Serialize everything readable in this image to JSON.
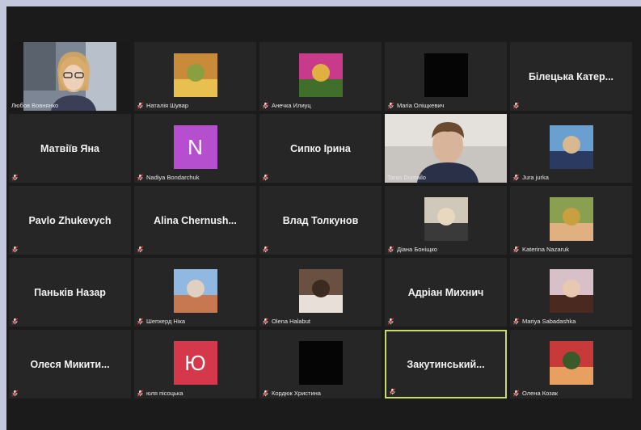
{
  "participants": [
    {
      "id": "t1",
      "name": "Любов Вовнянко",
      "display": "video",
      "muted": false
    },
    {
      "id": "t2",
      "name": "Наталія Шувар",
      "display": "photo",
      "muted": true,
      "colors": [
        "#c98a3a",
        "#e8c050",
        "#8aa040"
      ]
    },
    {
      "id": "t3",
      "name": "Анечка Илиуц",
      "display": "photo",
      "muted": true,
      "colors": [
        "#c83a8a",
        "#3f6f2a",
        "#e0b040"
      ]
    },
    {
      "id": "t4",
      "name": "Maria Оліщкевич",
      "display": "black",
      "muted": true
    },
    {
      "id": "t5",
      "name": "Білецька Катер...",
      "display": "name",
      "muted": true
    },
    {
      "id": "t6",
      "name": "Матвіїв Яна",
      "display": "name",
      "muted": true
    },
    {
      "id": "t7",
      "name": "Nadiya Bondarchuk",
      "display": "avatar",
      "initial": "N",
      "avatar_color": "#b54fd0",
      "muted": true
    },
    {
      "id": "t8",
      "name": "Сипко Ірина",
      "display": "name",
      "muted": true
    },
    {
      "id": "t9",
      "name": "Taras Dumailo",
      "display": "video",
      "muted": false
    },
    {
      "id": "t10",
      "name": "Jura jurka",
      "display": "photo",
      "muted": true,
      "colors": [
        "#6aa0d0",
        "#2a3a60",
        "#d8b890"
      ]
    },
    {
      "id": "t11",
      "name": "Pavlo Zhukevych",
      "display": "name",
      "muted": true
    },
    {
      "id": "t12",
      "name": "Alina  Chernush...",
      "display": "name",
      "muted": true
    },
    {
      "id": "t13",
      "name": "Влад Толкунов",
      "display": "name",
      "muted": true
    },
    {
      "id": "t14",
      "name": "Діана Боніщко",
      "display": "photo",
      "muted": true,
      "colors": [
        "#d0c8b8",
        "#3a3a3a",
        "#e8d8c0"
      ]
    },
    {
      "id": "t15",
      "name": "Katerina Nazaruk",
      "display": "photo",
      "muted": true,
      "colors": [
        "#8aa050",
        "#e0b080",
        "#c8a040"
      ]
    },
    {
      "id": "t16",
      "name": "Паньків Назар",
      "display": "name",
      "muted": true
    },
    {
      "id": "t17",
      "name": "Шепхерд Ніка",
      "display": "photo",
      "muted": true,
      "colors": [
        "#90b8e0",
        "#c87850",
        "#e0d0c0"
      ]
    },
    {
      "id": "t18",
      "name": "Olena Halabut",
      "display": "photo",
      "muted": true,
      "colors": [
        "#6a5040",
        "#e8e0d8",
        "#3a2a20"
      ]
    },
    {
      "id": "t19",
      "name": "Адріан Михнич",
      "display": "name",
      "muted": true
    },
    {
      "id": "t20",
      "name": "Mariya Sabadashka",
      "display": "photo",
      "muted": true,
      "colors": [
        "#d8c0c8",
        "#4a2a20",
        "#e8c8b0"
      ]
    },
    {
      "id": "t21",
      "name": "Олеся  Микити...",
      "display": "name",
      "muted": true
    },
    {
      "id": "t22",
      "name": "юля пісоцька",
      "display": "avatar",
      "initial": "Ю",
      "avatar_color": "#d4384a",
      "muted": true
    },
    {
      "id": "t23",
      "name": "Кордюк Христина",
      "display": "black",
      "muted": true
    },
    {
      "id": "t24",
      "name": "Закутинський...",
      "display": "name",
      "muted": true,
      "active_speaker": true
    },
    {
      "id": "t25",
      "name": "Олена Козак",
      "display": "photo",
      "muted": true,
      "colors": [
        "#c83a3a",
        "#e8a060",
        "#3a5a2a"
      ]
    }
  ]
}
